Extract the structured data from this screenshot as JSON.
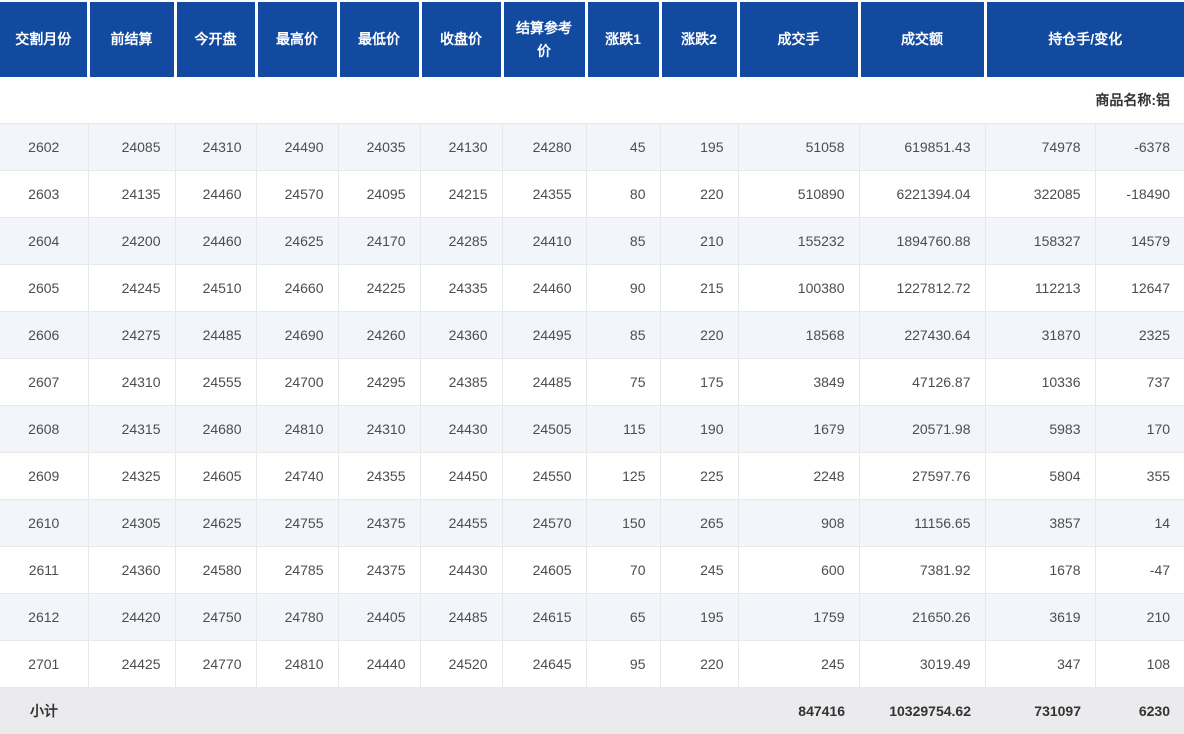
{
  "table": {
    "columns": [
      {
        "key": "delivery_month",
        "label": "交割月份"
      },
      {
        "key": "prev_settlement",
        "label": "前结算"
      },
      {
        "key": "open",
        "label": "今开盘"
      },
      {
        "key": "high",
        "label": "最高价"
      },
      {
        "key": "low",
        "label": "最低价"
      },
      {
        "key": "close",
        "label": "收盘价"
      },
      {
        "key": "settlement_ref",
        "label": "结算参考价"
      },
      {
        "key": "change1",
        "label": "涨跌1"
      },
      {
        "key": "change2",
        "label": "涨跌2"
      },
      {
        "key": "volume",
        "label": "成交手"
      },
      {
        "key": "turnover",
        "label": "成交额"
      },
      {
        "key": "open_interest_change",
        "label": "持仓手/变化"
      }
    ],
    "group_row": {
      "label": "商品名称:铝"
    },
    "rows": [
      {
        "cells": [
          "2602",
          "24085",
          "24310",
          "24490",
          "24035",
          "24130",
          "24280",
          "45",
          "195",
          "51058",
          "619851.43",
          "74978",
          "-6378"
        ]
      },
      {
        "cells": [
          "2603",
          "24135",
          "24460",
          "24570",
          "24095",
          "24215",
          "24355",
          "80",
          "220",
          "510890",
          "6221394.04",
          "322085",
          "-18490"
        ]
      },
      {
        "cells": [
          "2604",
          "24200",
          "24460",
          "24625",
          "24170",
          "24285",
          "24410",
          "85",
          "210",
          "155232",
          "1894760.88",
          "158327",
          "14579"
        ]
      },
      {
        "cells": [
          "2605",
          "24245",
          "24510",
          "24660",
          "24225",
          "24335",
          "24460",
          "90",
          "215",
          "100380",
          "1227812.72",
          "112213",
          "12647"
        ]
      },
      {
        "cells": [
          "2606",
          "24275",
          "24485",
          "24690",
          "24260",
          "24360",
          "24495",
          "85",
          "220",
          "18568",
          "227430.64",
          "31870",
          "2325"
        ]
      },
      {
        "cells": [
          "2607",
          "24310",
          "24555",
          "24700",
          "24295",
          "24385",
          "24485",
          "75",
          "175",
          "3849",
          "47126.87",
          "10336",
          "737"
        ]
      },
      {
        "cells": [
          "2608",
          "24315",
          "24680",
          "24810",
          "24310",
          "24430",
          "24505",
          "115",
          "190",
          "1679",
          "20571.98",
          "5983",
          "170"
        ]
      },
      {
        "cells": [
          "2609",
          "24325",
          "24605",
          "24740",
          "24355",
          "24450",
          "24550",
          "125",
          "225",
          "2248",
          "27597.76",
          "5804",
          "355"
        ]
      },
      {
        "cells": [
          "2610",
          "24305",
          "24625",
          "24755",
          "24375",
          "24455",
          "24570",
          "150",
          "265",
          "908",
          "11156.65",
          "3857",
          "14"
        ]
      },
      {
        "cells": [
          "2611",
          "24360",
          "24580",
          "24785",
          "24375",
          "24430",
          "24605",
          "70",
          "245",
          "600",
          "7381.92",
          "1678",
          "-47"
        ]
      },
      {
        "cells": [
          "2612",
          "24420",
          "24750",
          "24780",
          "24405",
          "24485",
          "24615",
          "65",
          "195",
          "1759",
          "21650.26",
          "3619",
          "210"
        ]
      },
      {
        "cells": [
          "2701",
          "24425",
          "24770",
          "24810",
          "24440",
          "24520",
          "24645",
          "95",
          "220",
          "245",
          "3019.49",
          "347",
          "108"
        ]
      }
    ],
    "subtotal": {
      "label": "小计",
      "volume": "847416",
      "turnover": "10329754.62",
      "open_interest": "731097",
      "oi_change": "6230"
    }
  },
  "colors": {
    "header_bg": "#124a9f",
    "header_text": "#ffffff",
    "group_row_bg": "#f9ab74",
    "row_alt_bg": "#f2f6fa",
    "row_bg": "#ffffff",
    "subtotal_bg": "#ebebee",
    "cell_border": "#e8e8e8",
    "data_text": "#4d4d4d"
  }
}
